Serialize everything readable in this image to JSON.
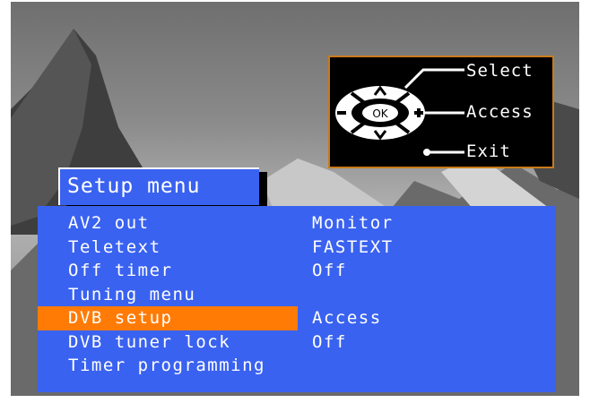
{
  "help": {
    "select_label": "Select",
    "access_label": "Access",
    "exit_label": "Exit",
    "ok_label": "OK"
  },
  "menu": {
    "title": "Setup menu",
    "items": [
      {
        "label": "AV2 out",
        "value": "Monitor",
        "selected": false
      },
      {
        "label": "Teletext",
        "value": "FASTEXT",
        "selected": false
      },
      {
        "label": "Off timer",
        "value": "Off",
        "selected": false
      },
      {
        "label": "Tuning menu",
        "value": "",
        "selected": false
      },
      {
        "label": "DVB setup",
        "value": "Access",
        "selected": true
      },
      {
        "label": "DVB tuner lock",
        "value": "Off",
        "selected": false
      },
      {
        "label": "Timer programming",
        "value": "",
        "selected": false
      }
    ]
  },
  "colors": {
    "panel": "#3a62f0",
    "highlight": "#ff7b05",
    "help_border": "#c97a1c"
  }
}
